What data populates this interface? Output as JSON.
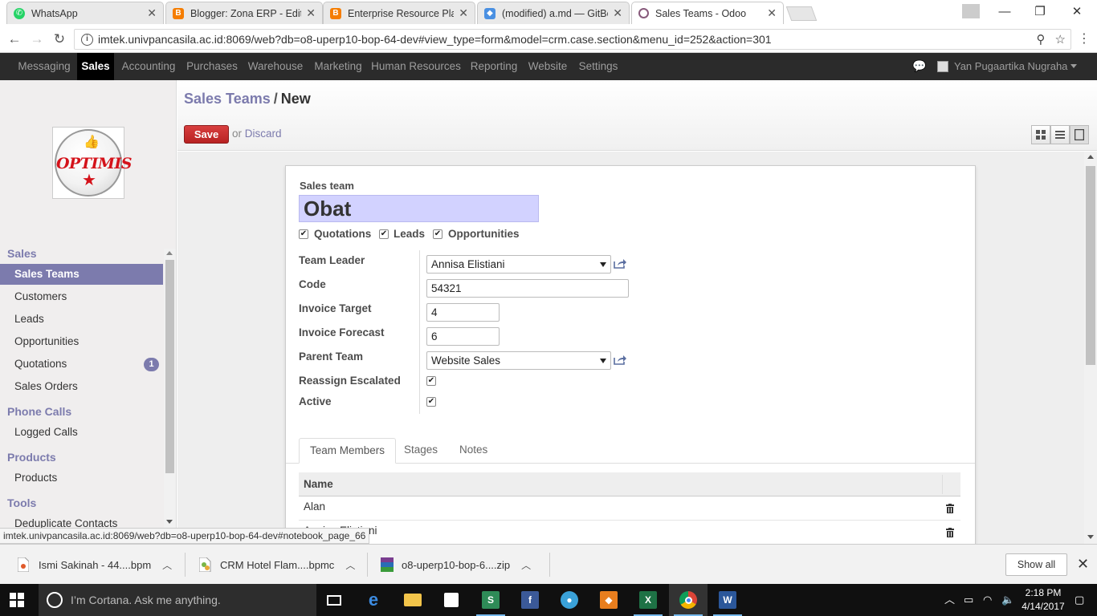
{
  "browser": {
    "tabs": [
      {
        "title": "WhatsApp",
        "icon": "whatsapp-icon",
        "color": "#25d366"
      },
      {
        "title": "Blogger: Zona ERP - Edit",
        "icon": "blogger-icon",
        "color": "#f57d00"
      },
      {
        "title": "Enterprise Resource Plan",
        "icon": "blogger-icon",
        "color": "#f57d00"
      },
      {
        "title": "(modified) a.md — GitBo",
        "icon": "gitbook-icon",
        "color": "#4a90e2"
      },
      {
        "title": "Sales Teams - Odoo",
        "icon": "odoo-icon",
        "color": "#875a7b"
      }
    ],
    "url": "imtek.univpancasila.ac.id:8069/web?db=o8-uperp10-bop-64-dev#view_type=form&model=crm.case.section&menu_id=252&action=301",
    "status_url": "imtek.univpancasila.ac.id:8069/web?db=o8-uperp10-bop-64-dev#notebook_page_66"
  },
  "topmenu": {
    "items": [
      "Messaging",
      "Sales",
      "Accounting",
      "Purchases",
      "Warehouse",
      "Marketing",
      "Human Resources",
      "Reporting",
      "Website",
      "Settings"
    ],
    "active": "Sales",
    "user": "Yan Pugaartika Nugraha"
  },
  "sidebar": {
    "logo_text": "OPTIMIS",
    "sections": [
      {
        "title": "Sales",
        "items": [
          {
            "label": "Sales Teams",
            "active": true
          },
          {
            "label": "Customers"
          },
          {
            "label": "Leads"
          },
          {
            "label": "Opportunities"
          },
          {
            "label": "Quotations",
            "badge": "1"
          },
          {
            "label": "Sales Orders"
          }
        ]
      },
      {
        "title": "Phone Calls",
        "items": [
          {
            "label": "Logged Calls"
          }
        ]
      },
      {
        "title": "Products",
        "items": [
          {
            "label": "Products"
          }
        ]
      },
      {
        "title": "Tools",
        "items": [
          {
            "label": "Deduplicate Contacts"
          }
        ]
      }
    ]
  },
  "header": {
    "breadcrumb_parent": "Sales Teams",
    "breadcrumb_sep": "/",
    "breadcrumb_current": "New",
    "save_label": "Save",
    "or_label": "or",
    "discard_label": "Discard"
  },
  "form": {
    "sales_team_label": "Sales team",
    "sales_team_value": "Obat",
    "checkboxes": [
      {
        "label": "Quotations",
        "checked": true
      },
      {
        "label": "Leads",
        "checked": true
      },
      {
        "label": "Opportunities",
        "checked": true
      }
    ],
    "fields": {
      "team_leader_label": "Team Leader",
      "team_leader_value": "Annisa Elistiani",
      "code_label": "Code",
      "code_value": "54321",
      "invoice_target_label": "Invoice Target",
      "invoice_target_value": "4",
      "invoice_forecast_label": "Invoice Forecast",
      "invoice_forecast_value": "6",
      "parent_team_label": "Parent Team",
      "parent_team_value": "Website Sales",
      "reassign_label": "Reassign Escalated",
      "reassign_checked": true,
      "active_label": "Active",
      "active_checked": true
    },
    "tabs": [
      "Team Members",
      "Stages",
      "Notes"
    ],
    "active_tab": "Team Members",
    "members_header": "Name",
    "members": [
      "Alan",
      "Annisa Elistiani"
    ]
  },
  "downloads": {
    "items": [
      "Ismi Sakinah - 44....bpm",
      "CRM Hotel Flam....bpmc",
      "o8-uperp10-bop-6....zip"
    ],
    "show_all": "Show all"
  },
  "taskbar": {
    "cortana_text": "I’m Cortana. Ask me anything.",
    "time": "2:18 PM",
    "date": "4/14/2017"
  },
  "colors": {
    "odoo_accent": "#7c7bad",
    "save_button": "#c62828",
    "topmenu_bg": "#2b2b2b"
  }
}
